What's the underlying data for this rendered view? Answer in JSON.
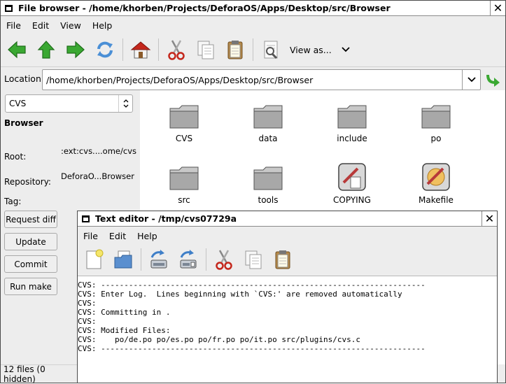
{
  "browser": {
    "title": "File browser - /home/khorben/Projects/DeforaOS/Apps/Desktop/src/Browser",
    "menu": [
      "File",
      "Edit",
      "View",
      "Help"
    ],
    "view_as_label": "View as...",
    "location_label": "Location:",
    "location_value": "/home/khorben/Projects/DeforaOS/Apps/Desktop/src/Browser",
    "sidebar": {
      "plugin_select": "CVS",
      "heading": "Browser",
      "root_label": "Root:",
      "root_value": ":ext:cvs....ome/cvs",
      "repository_label": "Repository:",
      "repository_value": "DeforaO...Browser",
      "tag_label": "Tag:",
      "buttons": [
        "Request diff",
        "Update",
        "Commit",
        "Run make"
      ]
    },
    "files": [
      {
        "name": "CVS",
        "kind": "folder"
      },
      {
        "name": "data",
        "kind": "folder"
      },
      {
        "name": "include",
        "kind": "folder"
      },
      {
        "name": "po",
        "kind": "folder"
      },
      {
        "name": "src",
        "kind": "folder"
      },
      {
        "name": "tools",
        "kind": "folder"
      },
      {
        "name": "COPYING",
        "kind": "text-document"
      },
      {
        "name": "Makefile",
        "kind": "makefile"
      }
    ],
    "status": "12 files (0 hidden)"
  },
  "editor": {
    "title": "Text editor - /tmp/cvs07729a",
    "menu": [
      "File",
      "Edit",
      "Help"
    ],
    "lines": [
      "CVS: ----------------------------------------------------------------------",
      "CVS: Enter Log.  Lines beginning with `CVS:' are removed automatically",
      "CVS:",
      "CVS: Committing in .",
      "CVS:",
      "CVS: Modified Files:",
      "CVS:    po/de.po po/es.po po/fr.po po/it.po src/plugins/cvs.c",
      "CVS: ----------------------------------------------------------------------"
    ]
  },
  "colors": {
    "nav_arrow": "#3aa832",
    "refresh": "#4a8fd6",
    "home_roof": "#c4271c",
    "folder": "#9c9c9c"
  }
}
